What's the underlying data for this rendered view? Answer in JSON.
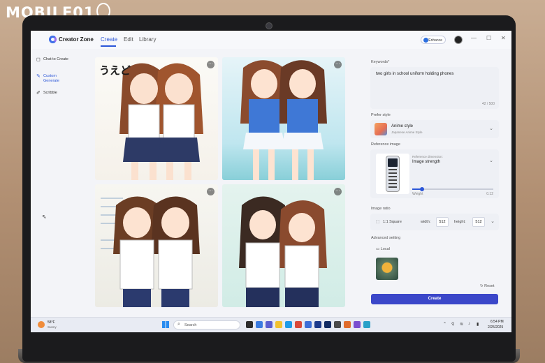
{
  "watermark": "MOBILE01",
  "app": {
    "title": "Creator Zone",
    "tabs": [
      {
        "label": "Create",
        "active": true
      },
      {
        "label": "Edit",
        "active": false
      },
      {
        "label": "Library",
        "active": false
      }
    ],
    "enhance_label": "Enhance",
    "window_controls": [
      "—",
      "☐",
      "✕"
    ]
  },
  "sidebar": {
    "items": [
      {
        "label": "Chat to Create",
        "icon": "chat-icon",
        "active": false
      },
      {
        "label": "Custom Generate",
        "icon": "brush-icon",
        "active": true
      },
      {
        "label": "Scribble",
        "icon": "pen-icon",
        "active": false
      }
    ]
  },
  "gallery": {
    "caption_top_left": "うえど",
    "more_glyph": "···"
  },
  "panel": {
    "keywords_label": "Keywords*",
    "keywords_value": "two girls in school uniform holding phones",
    "keywords_count": "42 / 500",
    "prefer_style_label": "Prefer style",
    "style_name": "Anime style",
    "style_sub": "Japanese Anime Style",
    "reference_label": "Reference image",
    "reference_dimension_label": "Reference dimension:",
    "reference_dimension_value": "Image strength",
    "weight_label": "Weight",
    "weight_value": "0.12",
    "weight_fraction": 0.12,
    "image_ratio_label": "Image ratio",
    "ratio_value": "1:1  Square",
    "width_label": "width:",
    "width_value": "512",
    "height_label": "height:",
    "height_value": "512",
    "advanced_label": "Advanced setting",
    "local_label": "Local",
    "reset_label": "Reset",
    "create_label": "Create"
  },
  "taskbar": {
    "weather_temp": "58°F",
    "weather_desc": "Sunny",
    "search_placeholder": "Search",
    "time": "6:54 PM",
    "date": "2/25/2025"
  },
  "colors": {
    "accent": "#2b56d8",
    "create_button": "#3b47c9"
  }
}
